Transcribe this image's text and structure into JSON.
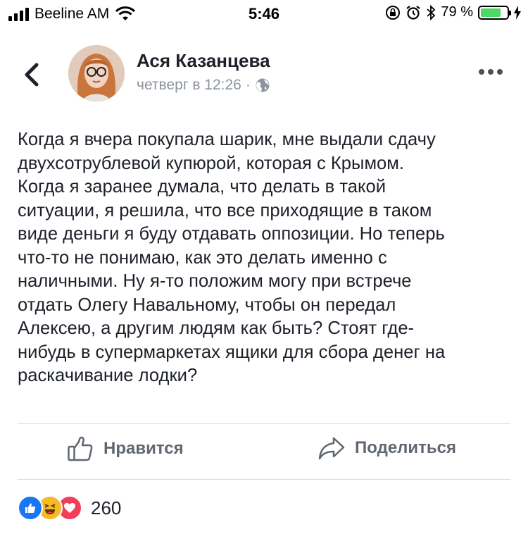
{
  "status_bar": {
    "carrier": "Beeline AM",
    "time": "5:46",
    "battery_percent": "79 %",
    "battery_level": 0.79,
    "icons": [
      "signal-icon",
      "wifi-icon",
      "location-lock-icon",
      "alarm-icon",
      "bluetooth-icon",
      "battery-icon",
      "charging-icon"
    ]
  },
  "header": {
    "author": "Ася Казанцева",
    "timestamp": "четверг в 12:26",
    "separator": "·",
    "icons": [
      "back-chevron-icon",
      "globe-icon",
      "more-dots-icon"
    ]
  },
  "post": {
    "lines": [
      "Когда я вчера покупала шарик, мне выдали сдачу",
      "двухсотрублевой купюрой, которая с Крымом.",
      "Когда я заранее думала, что делать в такой",
      "ситуации, я решила, что все приходящие в таком",
      "виде деньги я буду отдавать оппозиции. Но теперь",
      "что-то не понимаю, как это делать именно с",
      "наличными. Ну я-то положим могу при встрече",
      "отдать Олегу Навальному, чтобы он передал",
      "Алексею, а другим людям как быть? Стоят где-",
      "нибудь в супермаркетах ящики для сбора денег на",
      "раскачивание лодки?"
    ]
  },
  "actions": {
    "like_label": "Нравится",
    "share_label": "Поделиться"
  },
  "reactions": {
    "types": [
      "like-icon",
      "haha-icon",
      "love-icon"
    ],
    "count": "260"
  },
  "colors": {
    "like_blue": "#1877f2",
    "haha_yellow": "#f7b928",
    "love_red": "#f33e58",
    "battery_green": "#4cd964",
    "secondary_text": "#8d949e"
  }
}
